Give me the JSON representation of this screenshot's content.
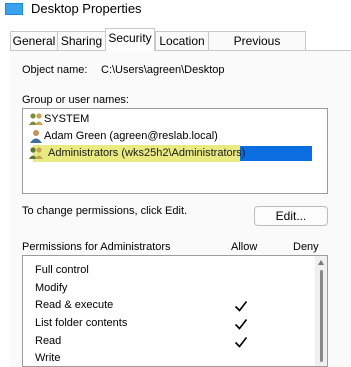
{
  "window": {
    "title": "Desktop Properties"
  },
  "tabs": [
    "General",
    "Sharing",
    "Security",
    "Location",
    "Previous Versions"
  ],
  "active_tab": "Security",
  "object": {
    "label": "Object name:",
    "value": "C:\\Users\\agreen\\Desktop"
  },
  "group_section": {
    "label": "Group or user names:",
    "users": [
      "SYSTEM",
      "Adam Green (agreen@reslab.local)",
      "Administrators (wks25h2\\Administrators)"
    ],
    "selected_index": 2
  },
  "change_text": "To change permissions, click Edit.",
  "edit_button": "Edit...",
  "permissions": {
    "header": "Permissions for Administrators",
    "allow_label": "Allow",
    "deny_label": "Deny",
    "rows": [
      {
        "name": "Full control",
        "allow": false,
        "deny": false
      },
      {
        "name": "Modify",
        "allow": false,
        "deny": false
      },
      {
        "name": "Read & execute",
        "allow": true,
        "deny": false
      },
      {
        "name": "List folder contents",
        "allow": true,
        "deny": false
      },
      {
        "name": "Read",
        "allow": true,
        "deny": false
      },
      {
        "name": "Write",
        "allow": false,
        "deny": false
      }
    ]
  },
  "colors": {
    "selection": "#0a6ee0",
    "highlight": "#e9ea7f",
    "title_icon": "#1f8ad6"
  },
  "icons": {
    "title": "folder-icon",
    "group_users": "users-icon",
    "single_user": "user-icon",
    "check": "check-icon"
  }
}
